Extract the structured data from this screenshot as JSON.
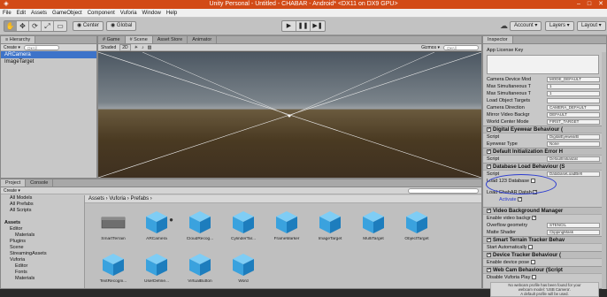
{
  "window": {
    "title": "Unity Personal - Untitled - CHABAR - Android* <DX11 on DX9 GPU>",
    "min": "–",
    "max": "□",
    "close": "✕"
  },
  "menu": [
    "File",
    "Edit",
    "Assets",
    "GameObject",
    "Component",
    "Vuforia",
    "Window",
    "Help"
  ],
  "toolbar": {
    "tools": [
      "✋",
      "✥",
      "⟳",
      "⤢",
      "▭"
    ],
    "pivot": "◉ Center",
    "space": "◉ Global",
    "play": "▶",
    "pause": "❚❚",
    "step": "▶❚",
    "account": "Account ▾",
    "layers": "Layers ▾",
    "layout": "Layout ▾",
    "cloud_icon": "☁"
  },
  "hierarchy": {
    "tab": "≡ Hierarchy",
    "create": "Create ▾",
    "search_placeholder": "Q▾All",
    "items": [
      "ARCamera",
      "ImageTarget"
    ]
  },
  "scene": {
    "tabs": [
      "# Game",
      "# Scene",
      "Asset Store",
      "Animator"
    ],
    "shading": "Shaded",
    "mode_2d": "2D",
    "gizmos": "Gizmos ▾",
    "search_placeholder": "Q▾All"
  },
  "project": {
    "tabs": [
      "Project",
      "Console"
    ],
    "create": "Create ▾",
    "tree": [
      {
        "label": "All Models",
        "indent": 1
      },
      {
        "label": "All Prefabs",
        "indent": 1
      },
      {
        "label": "All Scripts",
        "indent": 1
      },
      {
        "label": "",
        "indent": 0
      },
      {
        "label": "Assets",
        "indent": 0,
        "bold": true
      },
      {
        "label": "Editor",
        "indent": 1
      },
      {
        "label": "Materials",
        "indent": 2
      },
      {
        "label": "Plugins",
        "indent": 1
      },
      {
        "label": "Scene",
        "indent": 1
      },
      {
        "label": "StreamingAssets",
        "indent": 1
      },
      {
        "label": "Vuforia",
        "indent": 1
      },
      {
        "label": "Editor",
        "indent": 2
      },
      {
        "label": "Fonts",
        "indent": 2
      },
      {
        "label": "Materials",
        "indent": 2
      }
    ],
    "breadcrumb": "Assets › Vuforia › Prefabs ›",
    "assets": [
      "SmartTerrain",
      "ARCamera",
      "CloudRecog...",
      "CylinderTar...",
      "FrameMarker",
      "ImageTarget",
      "MultiTarget",
      "ObjectTarget",
      "TextRecogni...",
      "UserDefine...",
      "VirtualButton",
      "Word"
    ]
  },
  "inspector": {
    "tab": "Inspector",
    "app_license_label": "App License Key",
    "rows": [
      {
        "label": "Camera Device Mod",
        "value": "MODE_DEFAULT"
      },
      {
        "label": "Max Simultaneous T",
        "value": "1"
      },
      {
        "label": "Max Simultaneous T",
        "value": "1"
      },
      {
        "label": "Load Object Targets",
        "value": ""
      },
      {
        "label": "Camera Direction",
        "value": "CAMERA_DEFAULT"
      },
      {
        "label": "Mirror Video Backgr",
        "value": "DEFAULT"
      },
      {
        "label": "World Center Mode",
        "value": "FIRST_TARGET"
      }
    ],
    "digital_eyewear": {
      "header": "Digital Eyewear Behaviour (",
      "script_label": "Script",
      "script_value": "DigitalEyewearB",
      "type_label": "Eyewear Type",
      "type_value": "None"
    },
    "default_init": {
      "header": "Default Initialization Error H",
      "script_label": "Script",
      "script_value": "DefaultInitializat"
    },
    "database_load": {
      "header": "Database Load Behaviour (S",
      "script_label": "Script",
      "script_value": "DatabaseLoadBeh",
      "load_label": "Load 123 Database"
    },
    "chabar": {
      "load_label": "Load ChabAR Datab",
      "activate_label": "Activate"
    },
    "video_bg": {
      "header": "Video Background Manager",
      "enable_label": "Enable video backgr",
      "overflow_label": "Overflow geometry",
      "overflow_value": "STENCIL",
      "matte_label": "Matte Shader",
      "matte_value": "ClippingMask"
    },
    "smart_terrain": {
      "header": "Smart Terrain Tracker Behav",
      "auto_label": "Start Automatically"
    },
    "device_tracker": {
      "header": "Device Tracker Behaviour (",
      "pose_label": "Enable device pose"
    },
    "web_cam": {
      "header": "Web Cam Behaviour (Script",
      "disable_label": "Disable Vuforia Play",
      "note1": "No webcam profile has been found for your",
      "note2": "webcam model: 'USB Camera'.",
      "note3": "A default profile will be used."
    }
  }
}
